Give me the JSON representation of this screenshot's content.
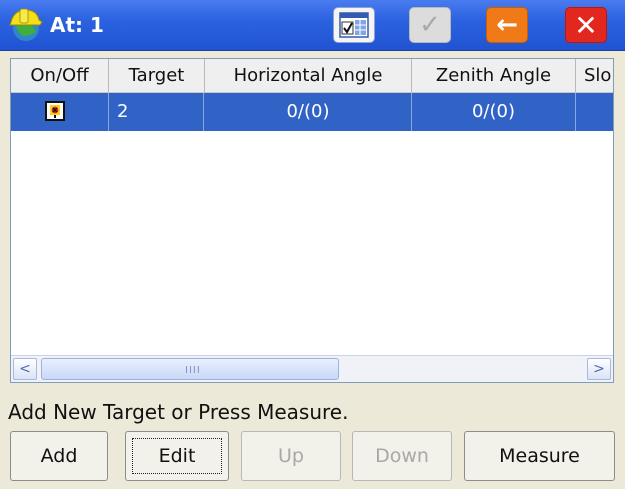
{
  "window": {
    "title": "At: 1",
    "icons": {
      "app": "hardhat-globe-icon",
      "table": "table-view-icon",
      "ok": "check-icon",
      "back": "arrow-left-icon",
      "close": "close-x-icon"
    },
    "colors": {
      "titlebar": "#2c62e0",
      "selection": "#3163c6",
      "back_button": "#f07a18",
      "close_button": "#e2281e"
    },
    "ok_glyph": "✓",
    "back_glyph": "←",
    "close_glyph": "✕"
  },
  "table": {
    "columns": [
      "On/Off",
      "Target",
      "Horizontal Angle",
      "Zenith Angle",
      "Slo"
    ],
    "rows": [
      {
        "on_off": "checked",
        "target": "2",
        "horizontal_angle": "0/(0)",
        "zenith_angle": "0/(0)",
        "slope": ""
      }
    ]
  },
  "scrollbar": {
    "left_glyph": "<",
    "right_glyph": ">",
    "grip": "IIII"
  },
  "status_text": "Add New Target or Press Measure.",
  "buttons": {
    "add": "Add",
    "edit": "Edit",
    "up": "Up",
    "down": "Down",
    "measure": "Measure"
  }
}
